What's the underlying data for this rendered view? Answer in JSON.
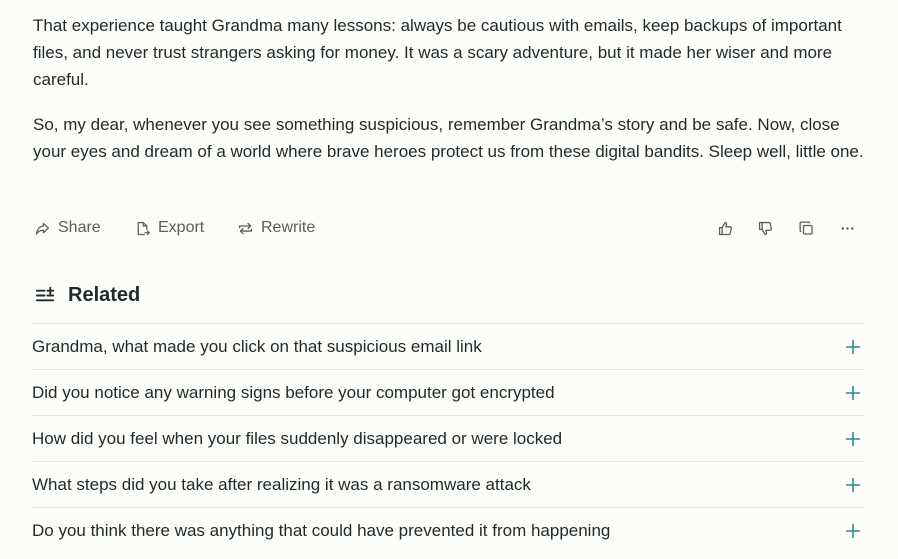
{
  "answer": {
    "paragraph1": "That experience taught Grandma many lessons: always be cautious with emails, keep backups of important files, and never trust strangers asking for money. It was a scary adventure, but it made her wiser and more careful.",
    "paragraph2": "So, my dear, whenever you see something suspicious, remember Grandma’s story and be safe. Now, close your eyes and dream of a world where brave heroes protect us from these digital bandits. Sleep well, little one."
  },
  "actions": {
    "share_label": "Share",
    "export_label": "Export",
    "rewrite_label": "Rewrite"
  },
  "related": {
    "title": "Related",
    "items": [
      {
        "label": "Grandma, what made you click on that suspicious email link"
      },
      {
        "label": "Did you notice any warning signs before your computer got encrypted"
      },
      {
        "label": "How did you feel when your files suddenly disappeared or were locked"
      },
      {
        "label": "What steps did you take after realizing it was a ransomware attack"
      },
      {
        "label": "Do you think there was anything that could have prevented it from happening"
      }
    ]
  },
  "colors": {
    "background": "#fcfcf9",
    "text": "#1f2a2b",
    "muted": "#55605f",
    "accent": "#2d8a95",
    "divider": "#e6e7e2"
  },
  "icons": [
    "share-icon",
    "export-icon",
    "rewrite-icon",
    "thumbs-up-icon",
    "thumbs-down-icon",
    "copy-icon",
    "more-icon",
    "related-list-icon",
    "plus-icon"
  ]
}
